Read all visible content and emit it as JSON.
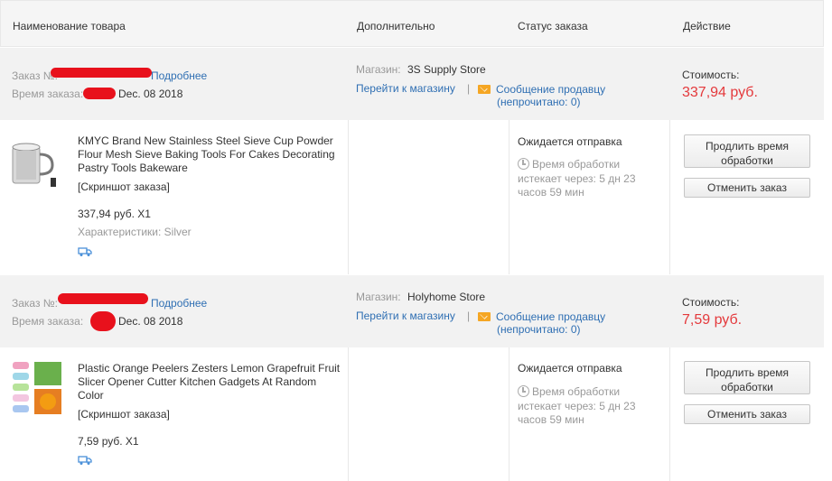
{
  "header": {
    "col_product": "Наименование товара",
    "col_extra": "Дополнительно",
    "col_status": "Статус заказа",
    "col_action": "Действие"
  },
  "orders": [
    {
      "order_label": "Заказ №:",
      "details_link": "Подробнее",
      "time_label": "Время заказа:",
      "time_value": "Dec. 08 2018",
      "store_label": "Магазин:",
      "store_name": "3S Supply Store",
      "go_to_store": "Перейти к магазину",
      "separator": "|",
      "message_seller": "Сообщение продавцу",
      "unread": "(непрочитано: 0)",
      "cost_label": "Стоимость:",
      "cost_value": "337,94 руб.",
      "item": {
        "title": "KMYC Brand New Stainless Steel Sieve Cup Powder Flour Mesh Sieve Baking Tools For Cakes Decorating Pastry Tools Bakeware",
        "snapshot": "[Скриншот заказа]",
        "price_qty": "337,94 руб. X1",
        "attributes": "Характеристики: Silver",
        "status": "Ожидается отправка",
        "processing": "Время обработки",
        "expires": "истекает через: 5 дн 23 часов 59 мин",
        "extend_button": "Продлить время обработки",
        "cancel_button": "Отменить заказ"
      }
    },
    {
      "order_label": "Заказ №:",
      "details_link": "Подробнее",
      "time_label": "Время заказа:",
      "time_value": "Dec. 08 2018",
      "store_label": "Магазин:",
      "store_name": "Holyhome Store",
      "go_to_store": "Перейти к магазину",
      "separator": "|",
      "message_seller": "Сообщение продавцу",
      "unread": "(непрочитано: 0)",
      "cost_label": "Стоимость:",
      "cost_value": "7,59 руб.",
      "item": {
        "title": "Plastic Orange Peelers Zesters Lemon Grapefruit Fruit Slicer Opener Cutter Kitchen Gadgets At Random Color",
        "snapshot": "[Скриншот заказа]",
        "price_qty": "7,59 руб. X1",
        "status": "Ожидается отправка",
        "processing": "Время обработки",
        "expires": "истекает через: 5 дн 23 часов 59 мин",
        "extend_button": "Продлить время обработки",
        "cancel_button": "Отменить заказ"
      }
    }
  ],
  "colors": {
    "link": "#2f6fb3",
    "price": "#e4393c",
    "envelope": "#f5a623"
  }
}
